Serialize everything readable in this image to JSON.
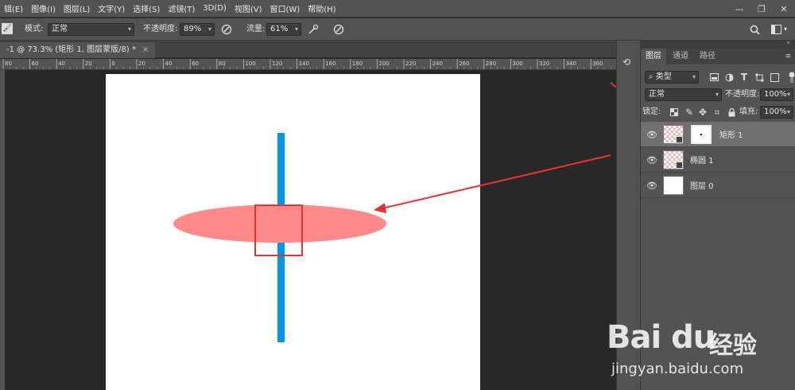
{
  "menubar": {
    "items": [
      "辑(E)",
      "图像(I)",
      "图层(L)",
      "文字(Y)",
      "选择(S)",
      "滤镜(T)",
      "3D(D)",
      "视图(V)",
      "窗口(W)",
      "帮助(H)"
    ]
  },
  "options": {
    "mode_label": "模式:",
    "mode_value": "正常",
    "opacity_label": "不透明度:",
    "opacity_value": "89%",
    "flow_label": "流量:",
    "flow_value": "61%"
  },
  "document": {
    "tab_title": "-1 @ 73.3% (矩形 1, 图层蒙版/8) *",
    "ruler_ticks": [
      "80",
      "60",
      "40",
      "20",
      "0",
      "20",
      "40",
      "60",
      "80",
      "100",
      "120",
      "140",
      "160",
      "180",
      "200",
      "220",
      "240",
      "260",
      "280",
      "300",
      "320",
      "340",
      "360"
    ]
  },
  "layers_panel": {
    "tabs": [
      "图层",
      "通道",
      "路径"
    ],
    "filter_value": "类型",
    "blend_value": "正常",
    "opacity_label": "不透明度:",
    "opacity_value": "100%",
    "lock_label": "锁定:",
    "fill_label": "填充:",
    "fill_value": "100%",
    "layers": [
      {
        "name": "矩形 1",
        "selected": true
      },
      {
        "name": "椭圆 1",
        "selected": false
      },
      {
        "name": "图层 0",
        "selected": false
      }
    ]
  },
  "watermark": {
    "brand": "Bai du",
    "sub_brand": "经验",
    "url": "jingyan.baidu.com"
  },
  "colors": {
    "accent_blue": "#0095e8",
    "ellipse": "#ff8a8a",
    "annotation_red": "#e83232"
  }
}
